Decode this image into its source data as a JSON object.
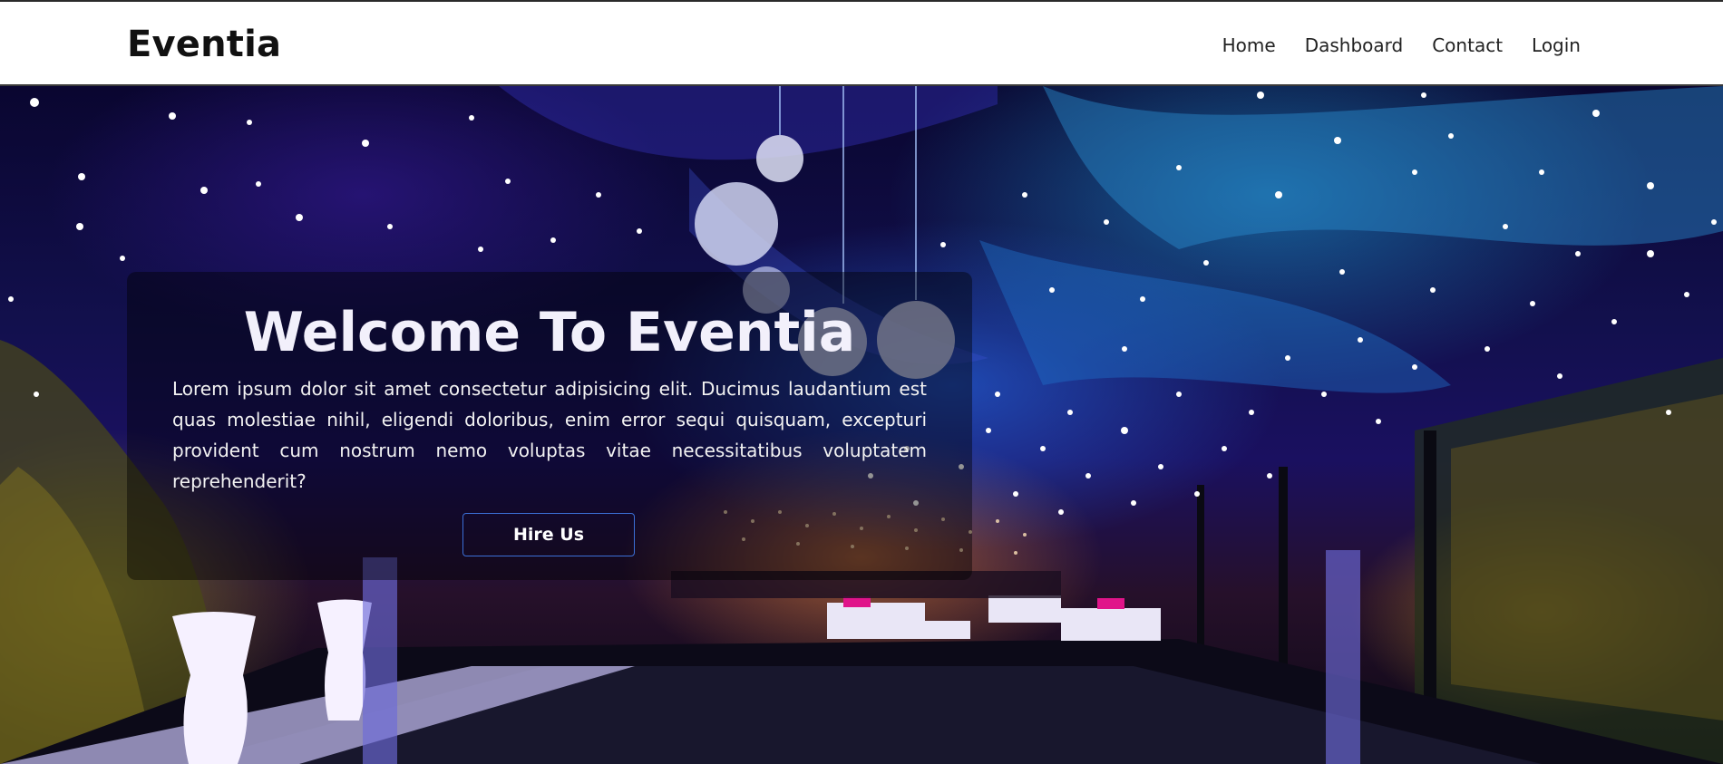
{
  "navbar": {
    "brand": "Eventia",
    "links": [
      "Home",
      "Dashboard",
      "Contact",
      "Login"
    ]
  },
  "hero": {
    "title": "Welcome To Eventia",
    "text": "Lorem ipsum dolor sit amet consectetur adipisicing elit. Ducimus laudantium est quas molestiae nihil, eligendi doloribus, enim error sequi quisquam, excepturi provident cum nostrum nemo voluptas vitae necessitatibus voluptatem reprehenderit?",
    "button_label": "Hire Us"
  },
  "colors": {
    "nav_bg": "#ffffff",
    "button_border": "#3b6fd6",
    "hero_text": "#f2f0fb"
  }
}
